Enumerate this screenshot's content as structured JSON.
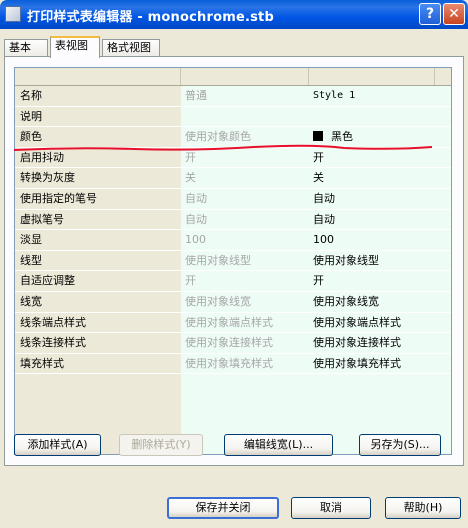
{
  "window": {
    "title": "打印样式表编辑器 - monochrome.stb",
    "help_label": "?",
    "close_label": "✕"
  },
  "tabs": [
    {
      "label": "基本"
    },
    {
      "label": "表视图"
    },
    {
      "label": "格式视图"
    }
  ],
  "table": {
    "rows": [
      {
        "name": "名称",
        "original": "普通",
        "value": "Style 1"
      },
      {
        "name": "说明",
        "original": "",
        "value": ""
      },
      {
        "name": "颜色",
        "original": "使用对象颜色",
        "value": "黑色"
      },
      {
        "name": "启用抖动",
        "original": "开",
        "value": "开"
      },
      {
        "name": "转换为灰度",
        "original": "关",
        "value": "关"
      },
      {
        "name": "使用指定的笔号",
        "original": "自动",
        "value": "自动"
      },
      {
        "name": "虚拟笔号",
        "original": "自动",
        "value": "自动"
      },
      {
        "name": "淡显",
        "original": "100",
        "value": "100"
      },
      {
        "name": "线型",
        "original": "使用对象线型",
        "value": "使用对象线型"
      },
      {
        "name": "自适应调整",
        "original": "开",
        "value": "开"
      },
      {
        "name": "线宽",
        "original": "使用对象线宽",
        "value": "使用对象线宽"
      },
      {
        "name": "线条端点样式",
        "original": "使用对象端点样式",
        "value": "使用对象端点样式"
      },
      {
        "name": "线条连接样式",
        "original": "使用对象连接样式",
        "value": "使用对象连接样式"
      },
      {
        "name": "填充样式",
        "original": "使用对象填充样式",
        "value": "使用对象填充样式"
      }
    ],
    "color_swatch": "#000000"
  },
  "actions": {
    "add_style": "添加样式(A)",
    "delete_style": "删除样式(Y)",
    "edit_lineweights": "编辑线宽(L)...",
    "save_as": "另存为(S)..."
  },
  "footer": {
    "save_close": "保存并关闭",
    "cancel": "取消",
    "help": "帮助(H)"
  },
  "colors": {
    "title_bar": "#0055e5",
    "annotation": "#e8102c"
  }
}
